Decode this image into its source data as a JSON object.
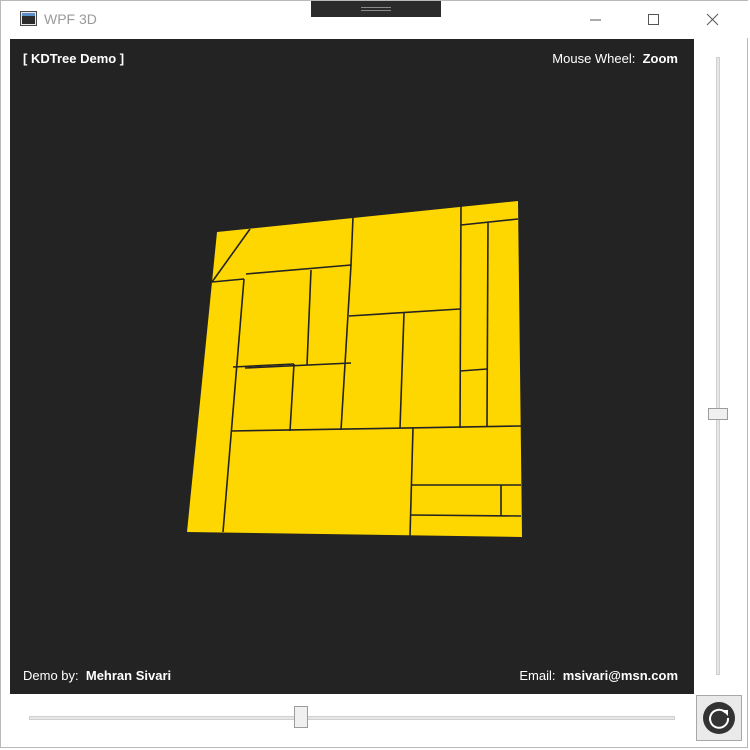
{
  "window": {
    "title": "WPF 3D"
  },
  "viewport": {
    "background": "#232323",
    "mesh_color": "#ffd700",
    "top_left_label": "[ KDTree Demo ]",
    "top_right": {
      "prefix": "Mouse Wheel:",
      "value": "Zoom"
    },
    "bottom_left": {
      "prefix": "Demo by:",
      "value": "Mehran Sivari"
    },
    "bottom_right": {
      "prefix": "Email:",
      "value": "msivari@msn.com"
    }
  },
  "controls": {
    "vertical_slider_value": 0.58,
    "horizontal_slider_value": 0.42,
    "reset_icon": "refresh-icon"
  }
}
